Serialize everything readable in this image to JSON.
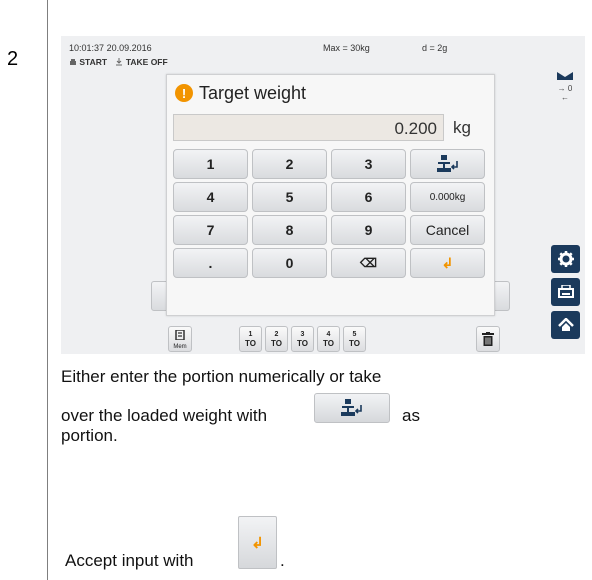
{
  "step": "2",
  "header": {
    "time": "10:01:37",
    "date": "20.09.2016",
    "max": "Max = 30kg",
    "d": "d = 2g",
    "start": "START",
    "take_off": "TAKE OFF"
  },
  "dialog": {
    "title": "Target weight",
    "value": "0.200",
    "unit": "kg",
    "keys": {
      "k1": "1",
      "k2": "2",
      "k3": "3",
      "k4": "4",
      "k5": "5",
      "k6": "6",
      "k7": "7",
      "k8": "8",
      "k9": "9",
      "kdot": ".",
      "k0": "0",
      "tare_value": "0.000kg",
      "cancel": "Cancel",
      "backspace": "⌫",
      "accept": "↲"
    }
  },
  "right_panel": {
    "zero": "→ 0 ←"
  },
  "bottom_bar": {
    "mem": "Mem",
    "to": [
      {
        "num": "1",
        "label": "TO"
      },
      {
        "num": "2",
        "label": "TO"
      },
      {
        "num": "3",
        "label": "TO"
      },
      {
        "num": "4",
        "label": "TO"
      },
      {
        "num": "5",
        "label": "TO"
      }
    ]
  },
  "instructions": {
    "line1": "Either enter the portion numerically or take",
    "line2a": "over the loaded weight with",
    "line2b": "as",
    "line3": "portion.",
    "line4": "Accept input with",
    "line4_end": "."
  }
}
